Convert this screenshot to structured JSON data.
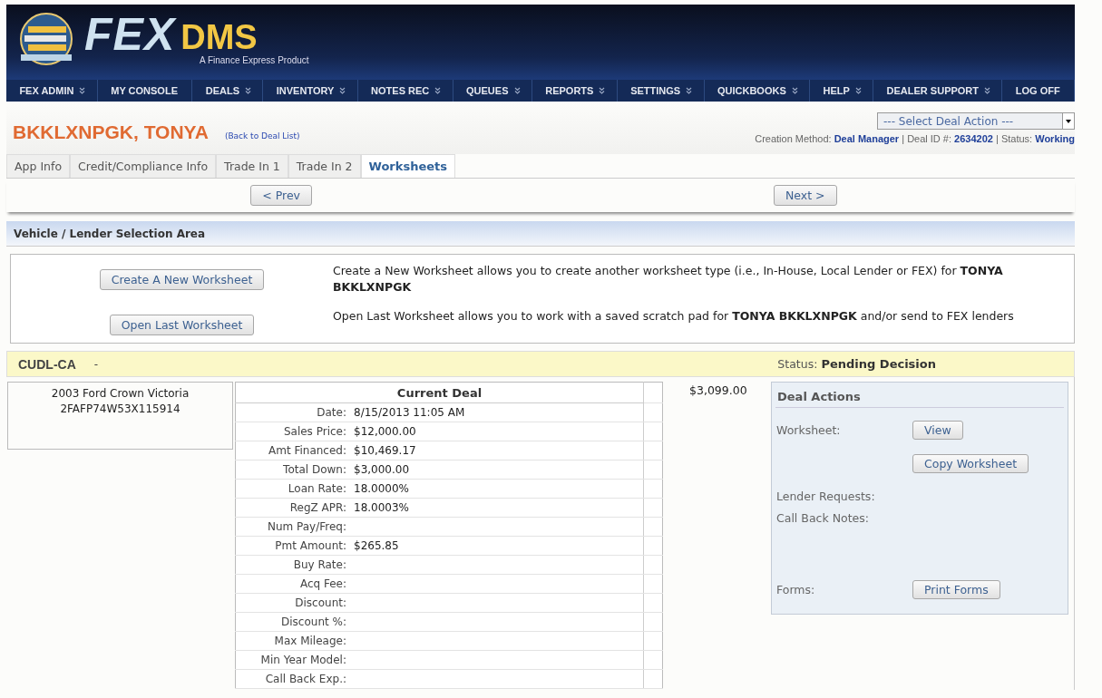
{
  "header": {
    "logo_main": "FEX",
    "logo_accent": "DMS",
    "tagline": "A Finance Express Product"
  },
  "nav": [
    {
      "label": "FEX ADMIN",
      "dropdown": true
    },
    {
      "label": "MY CONSOLE",
      "dropdown": false
    },
    {
      "label": "DEALS",
      "dropdown": true
    },
    {
      "label": "INVENTORY",
      "dropdown": true
    },
    {
      "label": "NOTES REC",
      "dropdown": true
    },
    {
      "label": "QUEUES",
      "dropdown": true
    },
    {
      "label": "REPORTS",
      "dropdown": true
    },
    {
      "label": "SETTINGS",
      "dropdown": true
    },
    {
      "label": "QUICKBOOKS",
      "dropdown": true
    },
    {
      "label": "HELP",
      "dropdown": true
    },
    {
      "label": "DEALER SUPPORT",
      "dropdown": true
    },
    {
      "label": "LOG OFF",
      "dropdown": false
    }
  ],
  "customer": {
    "name": "BKKLXNPGK, TONYA",
    "back_link": "(Back to Deal List)"
  },
  "deal_action_select": {
    "value": "--- Select Deal Action ---"
  },
  "deal_meta": "Creation Method: **Deal Manager** | Deal ID #: **2634202** | Status: **Working**",
  "tabs": [
    {
      "label": "App Info",
      "selected": false
    },
    {
      "label": "Credit/Compliance Info",
      "selected": false
    },
    {
      "label": "Trade In 1",
      "selected": false
    },
    {
      "label": "Trade In 2",
      "selected": false
    },
    {
      "label": "Worksheets",
      "selected": true
    }
  ],
  "pager": {
    "prev": "< Prev",
    "next": "Next >"
  },
  "section_title": "Vehicle / Lender Selection Area",
  "worksheet_options": [
    {
      "button": "Create A New Worksheet",
      "description": "Create a New Worksheet allows you to create another worksheet type (i.e., In-House, Local Lender or FEX) for **TONYA BKKLXNPGK**"
    },
    {
      "button": "Open Last Worksheet",
      "description": "Open Last Worksheet allows you to work with a saved scratch pad for **TONYA BKKLXNPGK** and/or send to FEX lenders"
    }
  ],
  "lender": {
    "name": "CUDL-CA",
    "dash": "-",
    "status_label": "Status:",
    "status": "Pending Decision"
  },
  "vehicle": {
    "description": "2003 Ford Crown Victoria",
    "vin": "2FAFP74W53X115914"
  },
  "current_deal": {
    "title": "Current Deal",
    "rows": [
      {
        "label": "Date:",
        "value": "8/15/2013 11:05 AM"
      },
      {
        "label": "Sales Price:",
        "value": "$12,000.00"
      },
      {
        "label": "Amt Financed:",
        "value": "$10,469.17"
      },
      {
        "label": "Total Down:",
        "value": "$3,000.00"
      },
      {
        "label": "Loan Rate:",
        "value": "18.0000%"
      },
      {
        "label": "RegZ APR:",
        "value": "18.0003%"
      },
      {
        "label": "Num Pay/Freq:"
      },
      {
        "label": "Pmt Amount:",
        "value": "$265.85"
      },
      {
        "label": "Buy Rate:"
      },
      {
        "label": "Acq Fee:"
      },
      {
        "label": "Discount:"
      },
      {
        "label": "Discount %:"
      },
      {
        "label": "Max Mileage:"
      },
      {
        "label": "Min Year Model:"
      },
      {
        "label": "Call Back Exp.:"
      }
    ]
  },
  "amount": "$3,099.00",
  "deal_actions": {
    "title": "Deal Actions",
    "rows": [
      {
        "kind": "action",
        "label": "Worksheet:",
        "button": "View"
      },
      {
        "kind": "action",
        "button": "Copy Worksheet"
      },
      {
        "kind": "text",
        "label": "Lender Requests:"
      },
      {
        "kind": "notes",
        "label": "Call Back Notes:"
      },
      {
        "kind": "action",
        "label": "Forms:",
        "button": "Print Forms"
      }
    ]
  }
}
